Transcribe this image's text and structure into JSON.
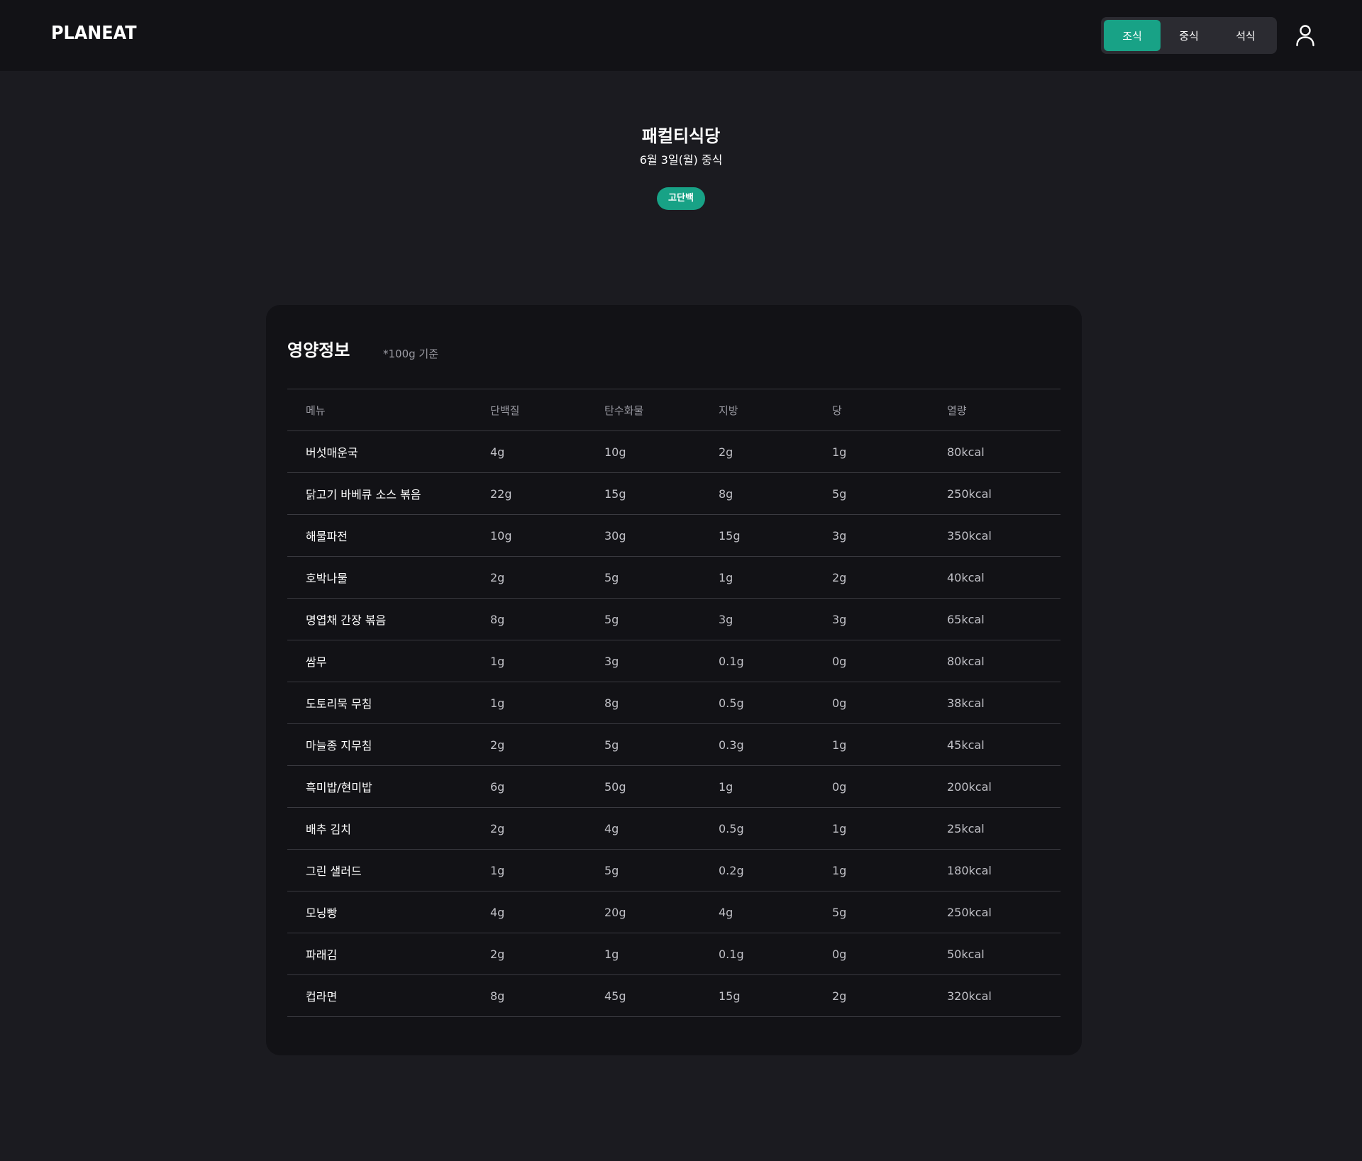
{
  "nav": {
    "logo": "PLANEAT",
    "meals": [
      {
        "label": "조식",
        "active": true
      },
      {
        "label": "중식",
        "active": false
      },
      {
        "label": "석식",
        "active": false
      }
    ],
    "user_icon": "user-icon"
  },
  "header": {
    "restaurant": "패컬티식당",
    "date_meal": "6월 3일(월) 중식",
    "tag": "고단백"
  },
  "nutrition": {
    "title": "영양정보",
    "note": "*100g 기준",
    "columns": {
      "name": "메뉴",
      "protein": "단백질",
      "carb": "탄수화물",
      "fat": "지방",
      "sugar": "당",
      "kcal": "열량"
    },
    "rows": [
      {
        "name": "버섯매운국",
        "protein": "4g",
        "carb": "10g",
        "fat": "2g",
        "sugar": "1g",
        "kcal": "80kcal"
      },
      {
        "name": "닭고기 바베큐 소스 볶음",
        "protein": "22g",
        "carb": "15g",
        "fat": "8g",
        "sugar": "5g",
        "kcal": "250kcal"
      },
      {
        "name": "해물파전",
        "protein": "10g",
        "carb": "30g",
        "fat": "15g",
        "sugar": "3g",
        "kcal": "350kcal"
      },
      {
        "name": "호박나물",
        "protein": "2g",
        "carb": "5g",
        "fat": "1g",
        "sugar": "2g",
        "kcal": "40kcal"
      },
      {
        "name": "명엽채 간장 볶음",
        "protein": "8g",
        "carb": "5g",
        "fat": "3g",
        "sugar": "3g",
        "kcal": "65kcal"
      },
      {
        "name": "쌈무",
        "protein": "1g",
        "carb": "3g",
        "fat": "0.1g",
        "sugar": "0g",
        "kcal": "80kcal"
      },
      {
        "name": "도토리묵 무침",
        "protein": "1g",
        "carb": "8g",
        "fat": "0.5g",
        "sugar": "0g",
        "kcal": "38kcal"
      },
      {
        "name": "마늘종 지무침",
        "protein": "2g",
        "carb": "5g",
        "fat": "0.3g",
        "sugar": "1g",
        "kcal": "45kcal"
      },
      {
        "name": "흑미밥/현미밥",
        "protein": "6g",
        "carb": "50g",
        "fat": "1g",
        "sugar": "0g",
        "kcal": "200kcal"
      },
      {
        "name": "배추 김치",
        "protein": "2g",
        "carb": "4g",
        "fat": "0.5g",
        "sugar": "1g",
        "kcal": "25kcal"
      },
      {
        "name": "그린 샐러드",
        "protein": "1g",
        "carb": "5g",
        "fat": "0.2g",
        "sugar": "1g",
        "kcal": "180kcal"
      },
      {
        "name": "모닝빵",
        "protein": "4g",
        "carb": "20g",
        "fat": "4g",
        "sugar": "5g",
        "kcal": "250kcal"
      },
      {
        "name": "파래김",
        "protein": "2g",
        "carb": "1g",
        "fat": "0.1g",
        "sugar": "0g",
        "kcal": "50kcal"
      },
      {
        "name": "컵라면",
        "protein": "8g",
        "carb": "45g",
        "fat": "15g",
        "sugar": "2g",
        "kcal": "320kcal"
      }
    ]
  },
  "colors": {
    "accent": "#18a286",
    "background": "#1b1b20",
    "surface": "#121216"
  }
}
